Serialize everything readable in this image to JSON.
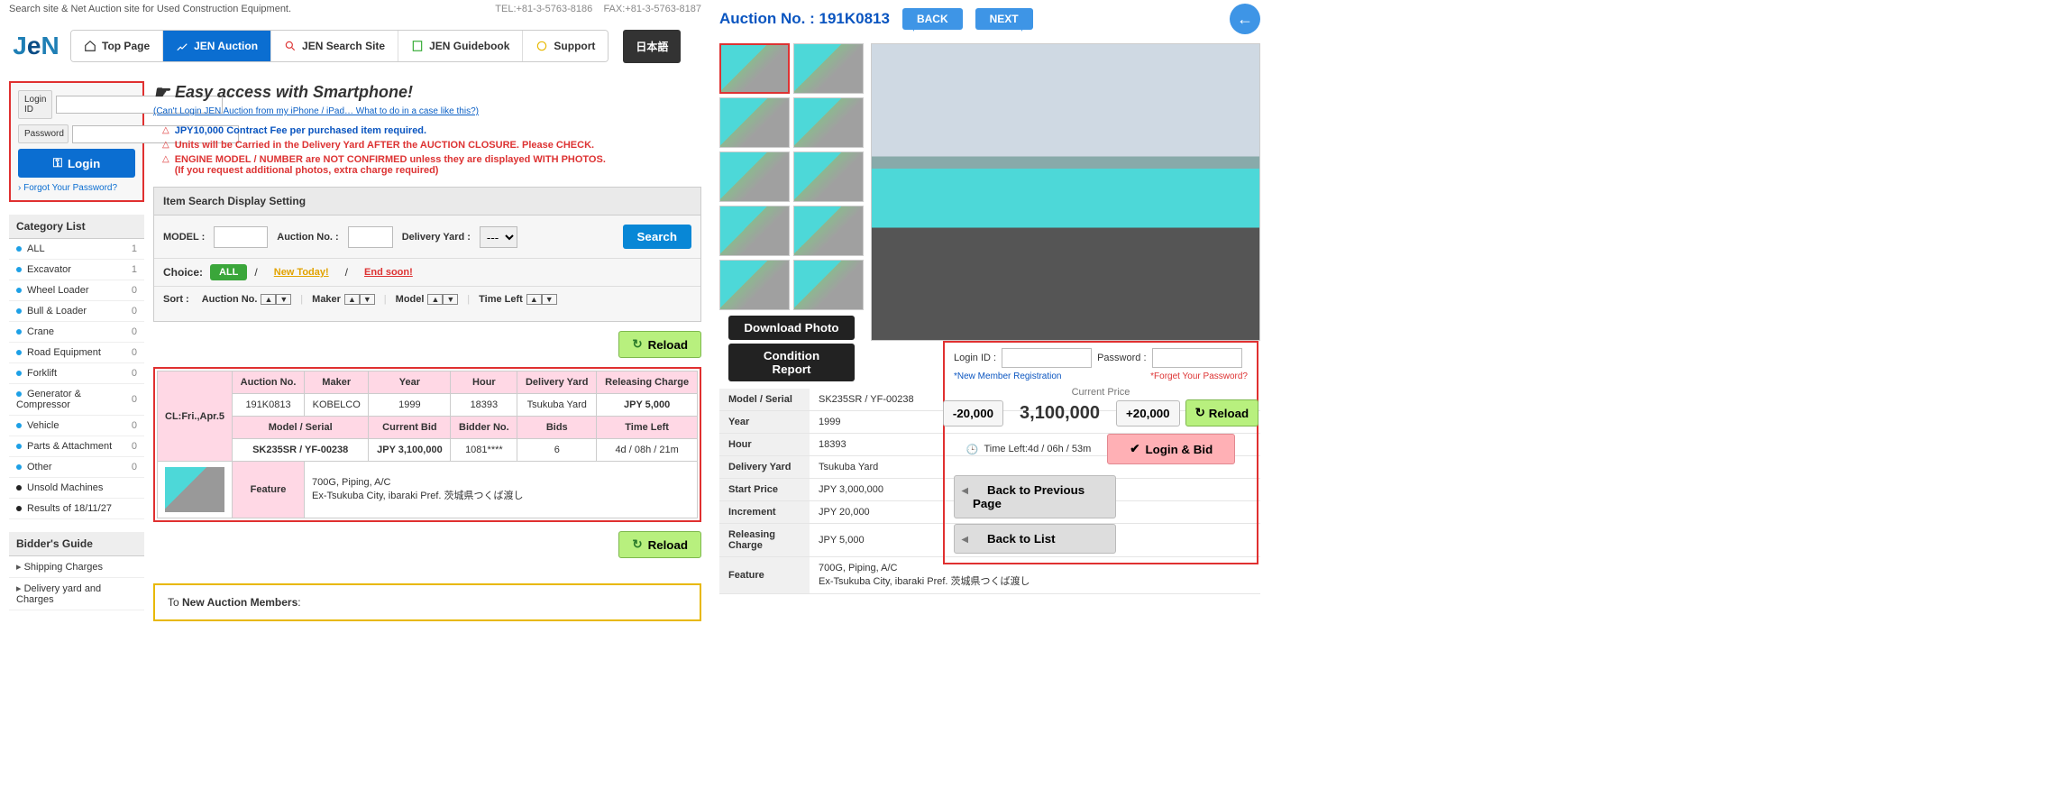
{
  "tagline": "Search site & Net Auction site for Used Construction Equipment.",
  "contact": {
    "tel": "TEL:+81-3-5763-8186",
    "fax": "FAX:+81-3-5763-8187"
  },
  "nav": {
    "top": "Top Page",
    "jen": "JEN Auction",
    "search": "JEN Search Site",
    "guide": "JEN Guidebook",
    "support": "Support",
    "jp": "日本語"
  },
  "login": {
    "id_label": "Login ID",
    "pw_label": "Password",
    "btn": "Login",
    "forgot": "Forgot Your Password?"
  },
  "category": {
    "title": "Category List",
    "items": [
      {
        "name": "ALL",
        "cnt": "1"
      },
      {
        "name": "Excavator",
        "cnt": "1"
      },
      {
        "name": "Wheel Loader",
        "cnt": "0"
      },
      {
        "name": "Bull & Loader",
        "cnt": "0"
      },
      {
        "name": "Crane",
        "cnt": "0"
      },
      {
        "name": "Road Equipment",
        "cnt": "0"
      },
      {
        "name": "Forklift",
        "cnt": "0"
      },
      {
        "name": "Generator & Compressor",
        "cnt": "0"
      },
      {
        "name": "Vehicle",
        "cnt": "0"
      },
      {
        "name": "Parts & Attachment",
        "cnt": "0"
      },
      {
        "name": "Other",
        "cnt": "0"
      },
      {
        "name": "Unsold Machines",
        "cnt": ""
      },
      {
        "name": "Results of 18/11/27",
        "cnt": ""
      }
    ]
  },
  "guide": {
    "title": "Bidder's Guide",
    "items": [
      "Shipping Charges",
      "Delivery yard and Charges"
    ]
  },
  "smart": {
    "title": "Easy access with Smartphone!",
    "link": "(Can't Login JEN Auction from my iPhone / iPad… What to do in a case like this?)"
  },
  "notices": [
    "JPY10,000 Contract Fee per purchased item required.",
    "Units will be Carried in the Delivery Yard AFTER the AUCTION CLOSURE. Please CHECK.",
    "ENGINE MODEL / NUMBER are NOT CONFIRMED unless they are displayed WITH PHOTOS.",
    "(If you request additional photos, extra charge required)"
  ],
  "searchpanel": {
    "title": "Item Search Display Setting",
    "model": "MODEL :",
    "auction": "Auction No. :",
    "yard": "Delivery Yard :",
    "yard_sel": "---",
    "btn": "Search",
    "choice": "Choice:",
    "all": "ALL",
    "new": "New Today!",
    "end": "End soon!",
    "sort": "Sort :",
    "sort_items": [
      "Auction No.",
      "Maker",
      "Model",
      "Time Left"
    ]
  },
  "reload": "Reload",
  "itemtable": {
    "cl": "CL:Fri.,Apr.5",
    "h": {
      "auction": "Auction No.",
      "maker": "Maker",
      "year": "Year",
      "hour": "Hour",
      "yard": "Delivery Yard",
      "release": "Releasing Charge",
      "model": "Model / Serial",
      "curbid": "Current Bid",
      "bidder": "Bidder No.",
      "bids": "Bids",
      "timeleft": "Time Left",
      "feature": "Feature"
    },
    "r1": {
      "auction": "191K0813",
      "maker": "KOBELCO",
      "year": "1999",
      "hour": "18393",
      "yard": "Tsukuba Yard",
      "release": "JPY 5,000"
    },
    "r2": {
      "model": "SK235SR / YF-00238",
      "curbid": "JPY 3,100,000",
      "bidder": "1081****",
      "bids": "6",
      "timeleft": "4d / 08h / 21m"
    },
    "feature_l1": "700G, Piping, A/C",
    "feature_l2": "Ex-Tsukuba City, ibaraki Pref. 茨城県つくば渡し"
  },
  "members": {
    "prefix": "To ",
    "bold": "New Auction Members",
    ":": ":"
  },
  "right": {
    "head": "Auction No. : 191K0813",
    "back": "BACK",
    "next": "NEXT",
    "download": "Download Photo",
    "condition": "Condition Report",
    "spec": [
      {
        "k": "Model / Serial",
        "v": "SK235SR / YF-00238"
      },
      {
        "k": "Year",
        "v": "1999"
      },
      {
        "k": "Hour",
        "v": "18393"
      },
      {
        "k": "Delivery Yard",
        "v": "Tsukuba Yard"
      },
      {
        "k": "Start Price",
        "v": "JPY 3,000,000"
      },
      {
        "k": "Increment",
        "v": "JPY 20,000"
      },
      {
        "k": "Releasing Charge",
        "v": "JPY 5,000"
      },
      {
        "k": "Feature",
        "v": "700G, Piping, A/C\nEx-Tsukuba City, ibaraki Pref. 茨城県つくば渡し"
      }
    ],
    "bid": {
      "login_id": "Login ID :",
      "password": "Password :",
      "newmember": "*New Member Registration",
      "forget": "*Forget Your Password?",
      "curprice": "Current Price",
      "minus": "-20,000",
      "plus": "+20,000",
      "price": "3,100,000",
      "reload": "Reload",
      "timeleft": "Time Left:4d / 06h / 53m",
      "loginbid": "Login & Bid",
      "backprev": "Back to Previous Page",
      "backlist": "Back to List"
    }
  }
}
